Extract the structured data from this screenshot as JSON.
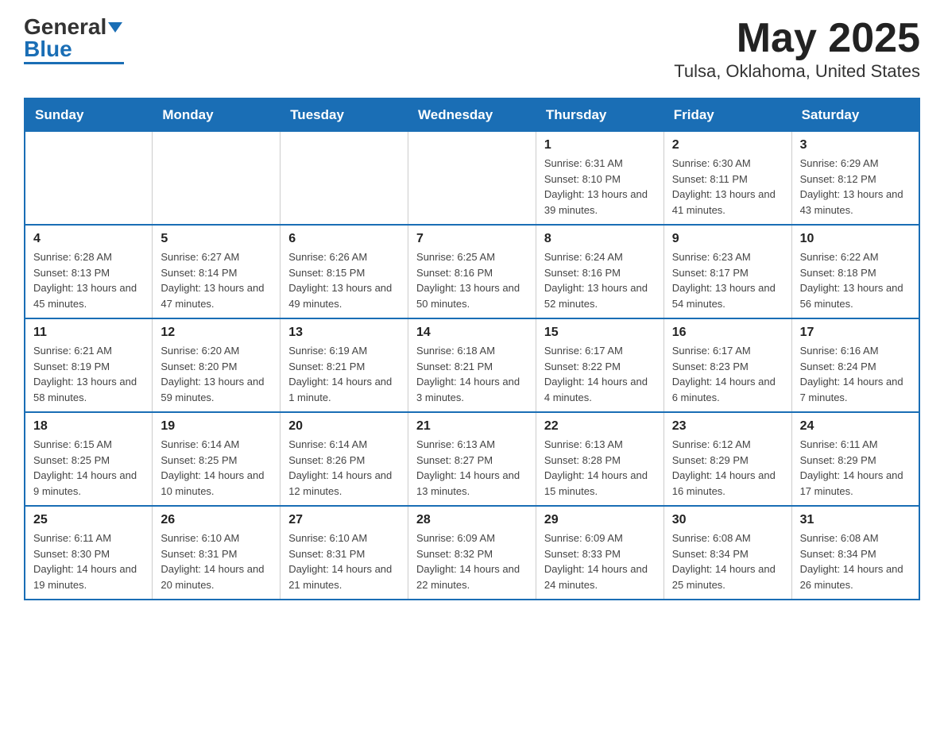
{
  "header": {
    "logo_general": "General",
    "logo_blue": "Blue",
    "month": "May 2025",
    "location": "Tulsa, Oklahoma, United States"
  },
  "days_of_week": [
    "Sunday",
    "Monday",
    "Tuesday",
    "Wednesday",
    "Thursday",
    "Friday",
    "Saturday"
  ],
  "weeks": [
    [
      {
        "day": "",
        "info": ""
      },
      {
        "day": "",
        "info": ""
      },
      {
        "day": "",
        "info": ""
      },
      {
        "day": "",
        "info": ""
      },
      {
        "day": "1",
        "info": "Sunrise: 6:31 AM\nSunset: 8:10 PM\nDaylight: 13 hours and 39 minutes."
      },
      {
        "day": "2",
        "info": "Sunrise: 6:30 AM\nSunset: 8:11 PM\nDaylight: 13 hours and 41 minutes."
      },
      {
        "day": "3",
        "info": "Sunrise: 6:29 AM\nSunset: 8:12 PM\nDaylight: 13 hours and 43 minutes."
      }
    ],
    [
      {
        "day": "4",
        "info": "Sunrise: 6:28 AM\nSunset: 8:13 PM\nDaylight: 13 hours and 45 minutes."
      },
      {
        "day": "5",
        "info": "Sunrise: 6:27 AM\nSunset: 8:14 PM\nDaylight: 13 hours and 47 minutes."
      },
      {
        "day": "6",
        "info": "Sunrise: 6:26 AM\nSunset: 8:15 PM\nDaylight: 13 hours and 49 minutes."
      },
      {
        "day": "7",
        "info": "Sunrise: 6:25 AM\nSunset: 8:16 PM\nDaylight: 13 hours and 50 minutes."
      },
      {
        "day": "8",
        "info": "Sunrise: 6:24 AM\nSunset: 8:16 PM\nDaylight: 13 hours and 52 minutes."
      },
      {
        "day": "9",
        "info": "Sunrise: 6:23 AM\nSunset: 8:17 PM\nDaylight: 13 hours and 54 minutes."
      },
      {
        "day": "10",
        "info": "Sunrise: 6:22 AM\nSunset: 8:18 PM\nDaylight: 13 hours and 56 minutes."
      }
    ],
    [
      {
        "day": "11",
        "info": "Sunrise: 6:21 AM\nSunset: 8:19 PM\nDaylight: 13 hours and 58 minutes."
      },
      {
        "day": "12",
        "info": "Sunrise: 6:20 AM\nSunset: 8:20 PM\nDaylight: 13 hours and 59 minutes."
      },
      {
        "day": "13",
        "info": "Sunrise: 6:19 AM\nSunset: 8:21 PM\nDaylight: 14 hours and 1 minute."
      },
      {
        "day": "14",
        "info": "Sunrise: 6:18 AM\nSunset: 8:21 PM\nDaylight: 14 hours and 3 minutes."
      },
      {
        "day": "15",
        "info": "Sunrise: 6:17 AM\nSunset: 8:22 PM\nDaylight: 14 hours and 4 minutes."
      },
      {
        "day": "16",
        "info": "Sunrise: 6:17 AM\nSunset: 8:23 PM\nDaylight: 14 hours and 6 minutes."
      },
      {
        "day": "17",
        "info": "Sunrise: 6:16 AM\nSunset: 8:24 PM\nDaylight: 14 hours and 7 minutes."
      }
    ],
    [
      {
        "day": "18",
        "info": "Sunrise: 6:15 AM\nSunset: 8:25 PM\nDaylight: 14 hours and 9 minutes."
      },
      {
        "day": "19",
        "info": "Sunrise: 6:14 AM\nSunset: 8:25 PM\nDaylight: 14 hours and 10 minutes."
      },
      {
        "day": "20",
        "info": "Sunrise: 6:14 AM\nSunset: 8:26 PM\nDaylight: 14 hours and 12 minutes."
      },
      {
        "day": "21",
        "info": "Sunrise: 6:13 AM\nSunset: 8:27 PM\nDaylight: 14 hours and 13 minutes."
      },
      {
        "day": "22",
        "info": "Sunrise: 6:13 AM\nSunset: 8:28 PM\nDaylight: 14 hours and 15 minutes."
      },
      {
        "day": "23",
        "info": "Sunrise: 6:12 AM\nSunset: 8:29 PM\nDaylight: 14 hours and 16 minutes."
      },
      {
        "day": "24",
        "info": "Sunrise: 6:11 AM\nSunset: 8:29 PM\nDaylight: 14 hours and 17 minutes."
      }
    ],
    [
      {
        "day": "25",
        "info": "Sunrise: 6:11 AM\nSunset: 8:30 PM\nDaylight: 14 hours and 19 minutes."
      },
      {
        "day": "26",
        "info": "Sunrise: 6:10 AM\nSunset: 8:31 PM\nDaylight: 14 hours and 20 minutes."
      },
      {
        "day": "27",
        "info": "Sunrise: 6:10 AM\nSunset: 8:31 PM\nDaylight: 14 hours and 21 minutes."
      },
      {
        "day": "28",
        "info": "Sunrise: 6:09 AM\nSunset: 8:32 PM\nDaylight: 14 hours and 22 minutes."
      },
      {
        "day": "29",
        "info": "Sunrise: 6:09 AM\nSunset: 8:33 PM\nDaylight: 14 hours and 24 minutes."
      },
      {
        "day": "30",
        "info": "Sunrise: 6:08 AM\nSunset: 8:34 PM\nDaylight: 14 hours and 25 minutes."
      },
      {
        "day": "31",
        "info": "Sunrise: 6:08 AM\nSunset: 8:34 PM\nDaylight: 14 hours and 26 minutes."
      }
    ]
  ]
}
